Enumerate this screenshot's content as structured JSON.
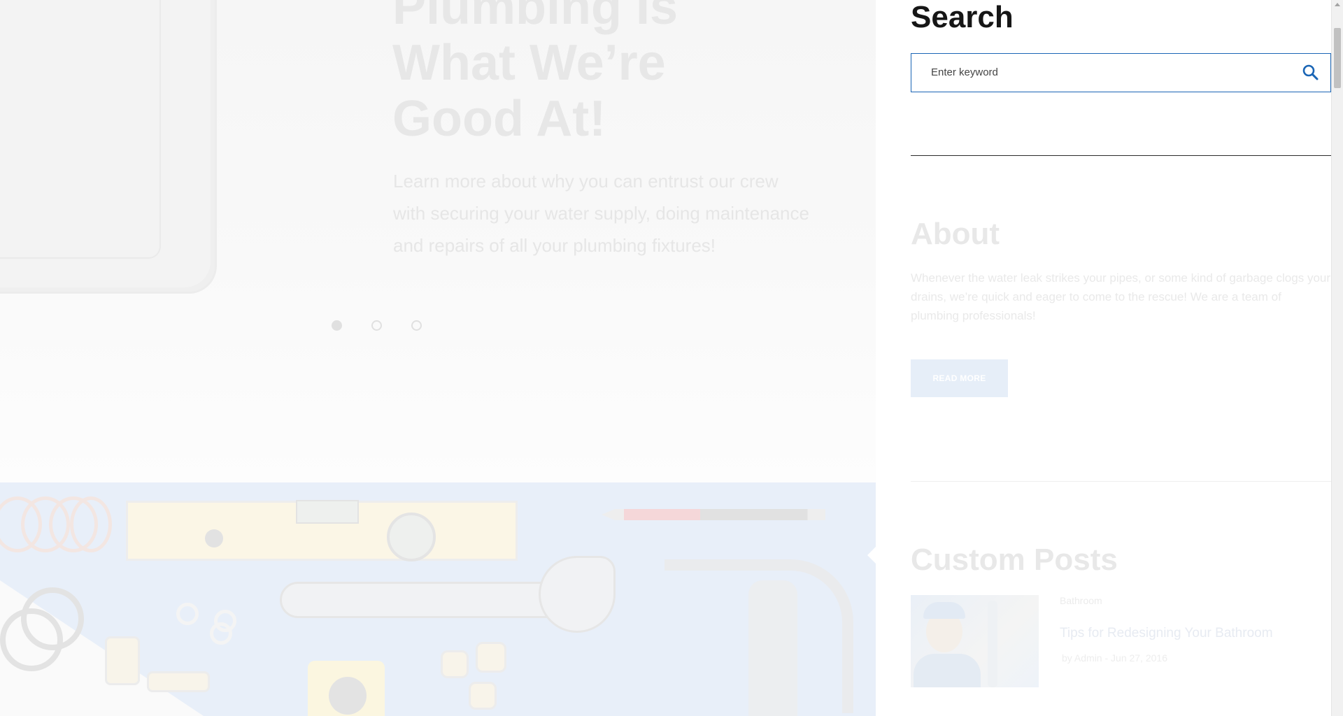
{
  "hero": {
    "title": "Plumbing Is What We’re Good At!",
    "subtitle": "Learn more about why you can entrust our crew with securing your water supply, doing maintenance and repairs of all your plumbing fixtures!",
    "slides": {
      "count": 3,
      "active_index": 1
    }
  },
  "sidebar": {
    "search": {
      "title": "Search",
      "placeholder": "Enter keyword",
      "value": ""
    },
    "about": {
      "title": "About",
      "text": "Whenever the water leak strikes your pipes, or some kind of garbage clogs your drains, we’re quick and eager to come to the rescue! We are a team of plumbing professionals!",
      "button_label": "READ MORE"
    },
    "custom_posts": {
      "title": "Custom Posts",
      "items": [
        {
          "category": "Bathroom",
          "title": "Tips for Redesigning Your Bathroom",
          "meta": "by Admin - Jun 27, 2016"
        }
      ]
    }
  },
  "colors": {
    "accent": "#1a65b5",
    "heading_dark": "#161616",
    "faded_text": "#e7e7e7",
    "button_faded": "#e6eef8"
  },
  "icons": {
    "search": "search-icon",
    "scroll_up": "scroll-up-arrow-icon"
  }
}
